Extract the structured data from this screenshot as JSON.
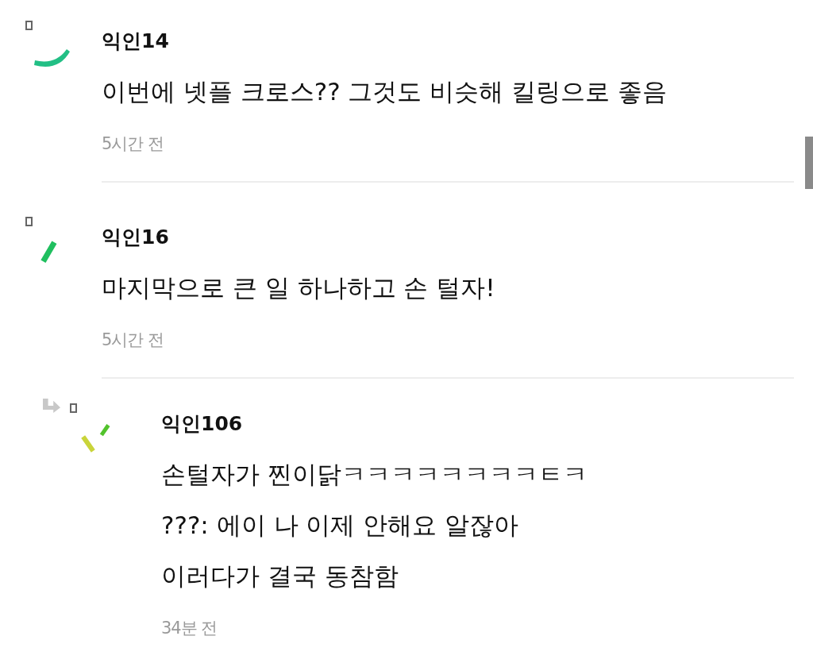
{
  "comments": [
    {
      "author": "익인14",
      "avatar": {
        "kind": "arc",
        "color": "#22bf85"
      },
      "lines": [
        "이번에 넷플 크로스?? 그것도 비슷해 킬링으로 좋음"
      ],
      "time": "5시간 전"
    },
    {
      "author": "익인16",
      "avatar": {
        "kind": "bar",
        "color": "#1fbf5f"
      },
      "lines": [
        "마지막으로 큰 일 하나하고 손 털자!"
      ],
      "time": "5시간 전",
      "replies": [
        {
          "author": "익인106",
          "avatar": {
            "kind": "pair",
            "color": "#c9d43a"
          },
          "lines": [
            "손털자가 찐이닭ㅋㅋㅋㅋㅋㅋㅋㅋㅌㅋ",
            "???: 에이 나 이제 안해요 알잖아",
            "이러다가 결국 동참함"
          ],
          "time": "34분 전"
        }
      ]
    }
  ]
}
